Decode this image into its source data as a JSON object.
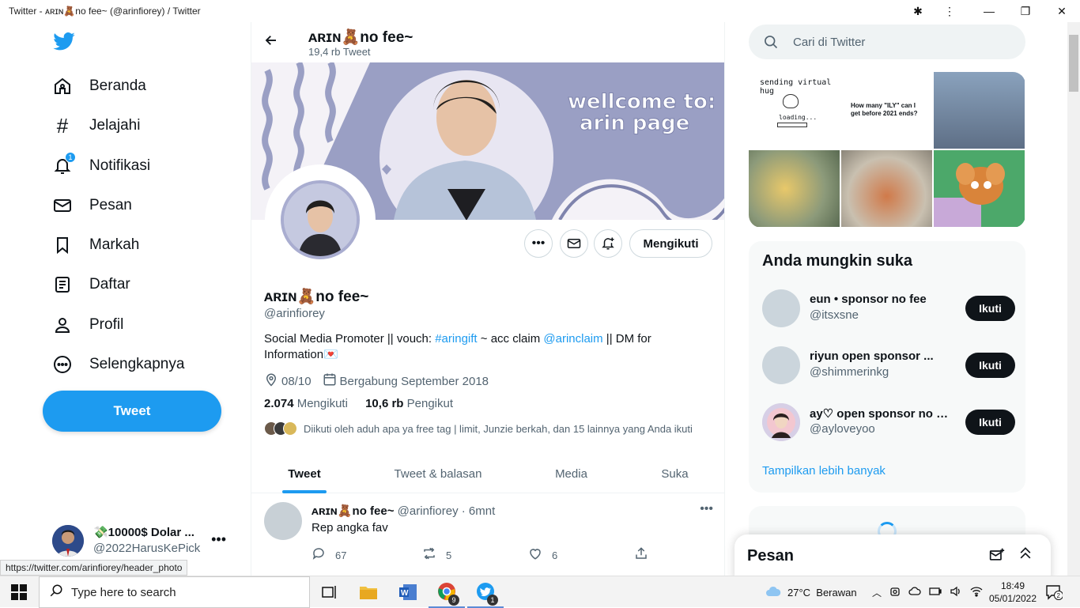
{
  "window": {
    "title": "Twitter - ᴀʀɪɴ🧸no fee~ (@arinfiorey) / Twitter"
  },
  "nav": {
    "items": [
      {
        "label": "Beranda"
      },
      {
        "label": "Jelajahi"
      },
      {
        "label": "Notifikasi",
        "badge": "1"
      },
      {
        "label": "Pesan"
      },
      {
        "label": "Markah"
      },
      {
        "label": "Daftar"
      },
      {
        "label": "Profil"
      },
      {
        "label": "Selengkapnya"
      }
    ],
    "tweet_button": "Tweet",
    "account": {
      "name": "💸10000$ Dolar ...",
      "handle": "@2022HarusKePick"
    }
  },
  "status_url": "https://twitter.com/arinfiorey/header_photo",
  "profile": {
    "header_name": "ᴀʀɪɴ🧸no fee~",
    "tweet_count": "19,4 rb Tweet",
    "banner_text_line1": "wellcome to:",
    "banner_text_line2": "arin page",
    "following_button": "Mengikuti",
    "name": "ᴀʀɪɴ🧸no fee~",
    "handle": "@arinfiorey",
    "bio_pre": "Social Media Promoter || vouch: ",
    "bio_link1": "#aringift",
    "bio_mid": " ~ acc claim ",
    "bio_link2": "@arinclaim",
    "bio_post": " ||  DM for Information💌",
    "birthday": "08/10",
    "joined": "Bergabung September 2018",
    "following_count": "2.074",
    "following_label": "Mengikuti",
    "followers_count": "10,6 rb",
    "followers_label": "Pengikut",
    "followed_by": "Diikuti oleh aduh apa ya free tag | limit, Junzie berkah, dan 15 lainnya yang Anda ikuti"
  },
  "tabs": [
    {
      "label": "Tweet",
      "active": true
    },
    {
      "label": "Tweet & balasan"
    },
    {
      "label": "Media"
    },
    {
      "label": "Suka"
    }
  ],
  "tweet": {
    "name": "ᴀʀɪɴ🧸no fee~",
    "meta": "@arinfiorey · 6mnt",
    "text": "Rep angka fav",
    "replies": "67",
    "retweets": "5",
    "likes": "6"
  },
  "right": {
    "search_placeholder": "Cari di Twitter",
    "media": [
      {
        "caption": "sending virtual hug",
        "sub": "loading..."
      },
      {
        "caption": "How many \"ILY\" can I get before 2021 ends?"
      },
      {
        "caption": ""
      },
      {
        "caption": ""
      },
      {
        "caption": ""
      },
      {
        "caption": ""
      }
    ],
    "suggest_title": "Anda mungkin suka",
    "suggestions": [
      {
        "name": "eun • sponsor no fee",
        "handle": "@itsxsne",
        "button": "Ikuti"
      },
      {
        "name": "riyun       open sponsor ...",
        "handle": "@shimmerinkg",
        "button": "Ikuti"
      },
      {
        "name": "ay♡ open sponsor no fee",
        "handle": "@ayloveyoo",
        "button": "Ikuti"
      }
    ],
    "show_more": "Tampilkan lebih banyak",
    "messages_title": "Pesan"
  },
  "taskbar": {
    "search_placeholder": "Type here to search",
    "weather": "27°C  Berawan",
    "time": "18:49",
    "date": "05/01/2022",
    "notif_count": "2",
    "chrome_badge": "9",
    "twitter_badge": "1"
  },
  "colors": {
    "accent": "#1d9bf0",
    "banner": "#9a9fc4"
  }
}
